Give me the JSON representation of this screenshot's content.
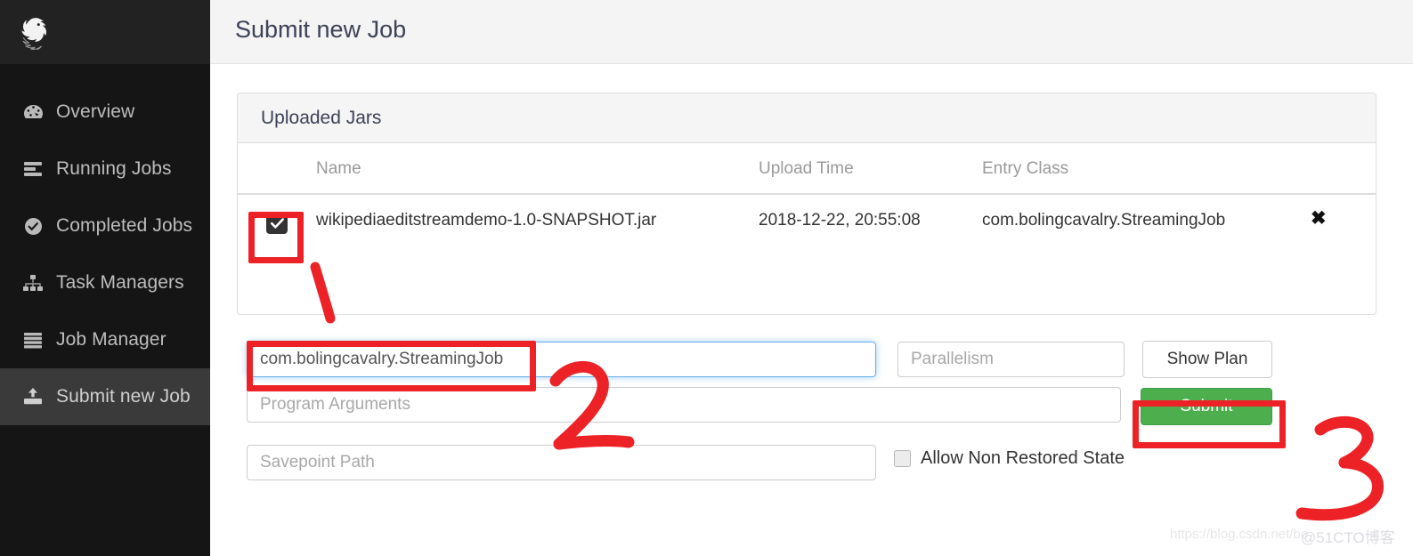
{
  "app": {
    "logo_icon": "flink-squirrel-logo",
    "header": {
      "title": "Submit new Job"
    }
  },
  "sidebar": {
    "items": [
      {
        "label": "Overview",
        "icon": "dashboard-icon",
        "active": false
      },
      {
        "label": "Running Jobs",
        "icon": "list-bars-icon",
        "active": false
      },
      {
        "label": "Completed Jobs",
        "icon": "check-circle-icon",
        "active": false
      },
      {
        "label": "Task Managers",
        "icon": "sitemap-icon",
        "active": false
      },
      {
        "label": "Job Manager",
        "icon": "server-icon",
        "active": false
      },
      {
        "label": "Submit new Job",
        "icon": "upload-icon",
        "active": true
      }
    ]
  },
  "panel": {
    "title": "Uploaded Jars",
    "table": {
      "columns": [
        "Name",
        "Upload Time",
        "Entry Class"
      ],
      "rows": [
        {
          "selected": true,
          "name": "wikipediaeditstreamdemo-1.0-SNAPSHOT.jar",
          "upload_time": "2018-12-22, 20:55:08",
          "entry_class": "com.bolingcavalry.StreamingJob",
          "delete_icon": "close-x-icon"
        }
      ]
    }
  },
  "form": {
    "entry_class": {
      "value": "com.bolingcavalry.StreamingJob",
      "placeholder": "Entry Class",
      "focused": true
    },
    "parallelism": {
      "value": "",
      "placeholder": "Parallelism"
    },
    "program_arguments": {
      "value": "",
      "placeholder": "Program Arguments"
    },
    "savepoint_path": {
      "value": "",
      "placeholder": "Savepoint Path"
    },
    "show_plan_label": "Show Plan",
    "submit_label": "Submit",
    "allow_non_restored_state": {
      "label": "Allow Non Restored State",
      "checked": false
    }
  },
  "annotations": {
    "step_1": "1",
    "step_2": "2",
    "step_3": "3",
    "color": "#ec2227",
    "boxes": [
      "jar-checkbox",
      "entry-class-input",
      "submit-button"
    ]
  },
  "watermarks": {
    "csdn": "https://blog.csdn.net/bo",
    "cto": "@51CTO博客"
  },
  "colors": {
    "sidebar_bg": "#151515",
    "sidebar_logo_bg": "#222222",
    "sidebar_active_bg": "#3a3a3a",
    "header_bg": "#f4f4f4",
    "panel_head_bg": "#f5f5f5",
    "submit_green": "#4cae4c",
    "focus_blue": "#66afe9",
    "annotation_red": "#ec2227"
  }
}
